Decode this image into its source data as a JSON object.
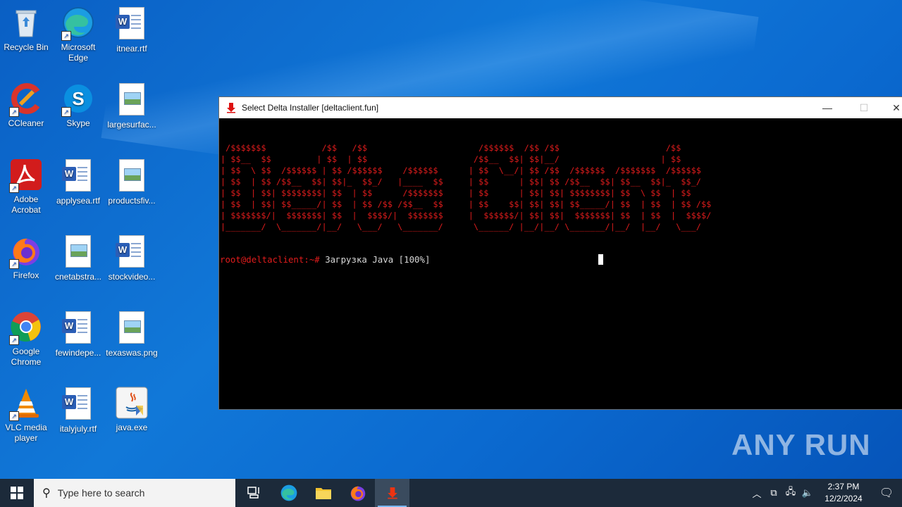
{
  "desktop": {
    "icons": [
      {
        "label": "Recycle Bin",
        "icon": "recycle-bin-icon"
      },
      {
        "label": "Microsoft Edge",
        "icon": "edge-icon"
      },
      {
        "label": "itnear.rtf",
        "icon": "word-document-icon"
      },
      {
        "label": "CCleaner",
        "icon": "ccleaner-icon"
      },
      {
        "label": "Skype",
        "icon": "skype-icon"
      },
      {
        "label": "largesurfac...",
        "icon": "image-file-icon"
      },
      {
        "label": "Adobe Acrobat",
        "icon": "acrobat-icon"
      },
      {
        "label": "applysea.rtf",
        "icon": "word-document-icon"
      },
      {
        "label": "productsfiv...",
        "icon": "image-file-icon"
      },
      {
        "label": "Firefox",
        "icon": "firefox-icon"
      },
      {
        "label": "cnetabstra...",
        "icon": "image-file-icon"
      },
      {
        "label": "stockvideo...",
        "icon": "word-document-icon"
      },
      {
        "label": "Google Chrome",
        "icon": "chrome-icon"
      },
      {
        "label": "fewindepe...",
        "icon": "word-document-icon"
      },
      {
        "label": "texaswas.png",
        "icon": "image-file-icon"
      },
      {
        "label": "VLC media player",
        "icon": "vlc-icon"
      },
      {
        "label": "italyjuly.rtf",
        "icon": "word-document-icon"
      },
      {
        "label": "java.exe",
        "icon": "java-icon"
      }
    ]
  },
  "window": {
    "title": "Select Delta Installer [deltaclient.fun]",
    "minimize": "—",
    "maximize": "☐",
    "close": "✕"
  },
  "terminal": {
    "ascii_banner": " /$$$$$$$           /$$   /$$                      /$$$$$$  /$$ /$$                     /$$\n| $$__  $$         | $$  | $$                     /$$__  $$| $$|__/                    | $$\n| $$  \\ $$  /$$$$$$ | $$ /$$$$$$    /$$$$$$      | $$  \\__/| $$ /$$  /$$$$$$  /$$$$$$$  /$$$$$$\n| $$  | $$ /$$__  $$| $$|_  $$_/   |____  $$     | $$      | $$| $$ /$$__  $$| $$__  $$|_  $$_/\n| $$  | $$| $$$$$$$$| $$  | $$      /$$$$$$$     | $$      | $$| $$| $$$$$$$$| $$  \\ $$  | $$\n| $$  | $$| $$_____/| $$  | $$ /$$ /$$__  $$     | $$    $$| $$| $$| $$_____/| $$  | $$  | $$ /$$\n| $$$$$$$/|  $$$$$$$| $$  |  $$$$/|  $$$$$$$     |  $$$$$$/| $$| $$|  $$$$$$$| $$  | $$  |  $$$$/\n|_______/  \\_______/|__/   \\___/   \\_______/      \\______/ |__/|__/ \\_______/|__/  |__/   \\___/",
    "prompt": "root@deltaclient:~#",
    "command_output": " Загрузка Java [100%]"
  },
  "watermark": "ANY RUN",
  "taskbar": {
    "search_placeholder": "Type here to search",
    "time": "2:37 PM",
    "date": "12/2/2024"
  }
}
